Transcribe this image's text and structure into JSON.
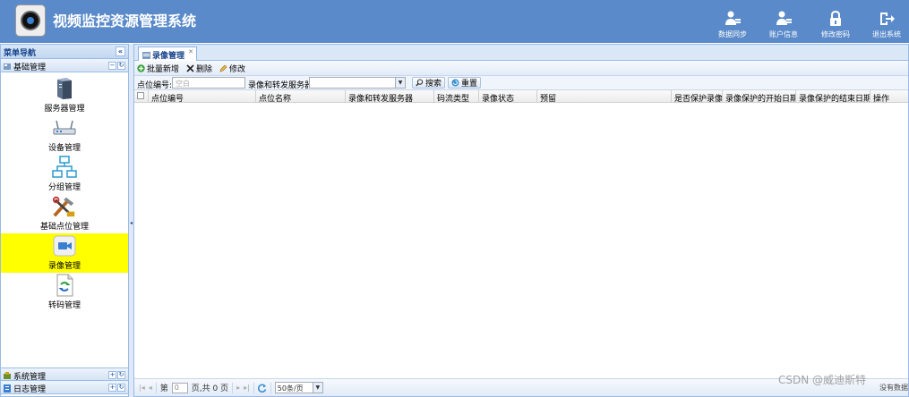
{
  "app": {
    "title": "视频监控资源管理系统"
  },
  "header_buttons": [
    {
      "label": "数据同步",
      "icon": "data-sync-icon"
    },
    {
      "label": "账户信息",
      "icon": "account-info-icon"
    },
    {
      "label": "修改密码",
      "icon": "lock-icon"
    },
    {
      "label": "退出系统",
      "icon": "logout-icon"
    }
  ],
  "left_panel": {
    "title": "菜单导航",
    "sections": [
      {
        "label": "基础管理",
        "expanded": true
      },
      {
        "label": "系统管理"
      },
      {
        "label": "日志管理"
      }
    ],
    "menu_items": [
      {
        "label": "服务器管理",
        "icon": "server-icon",
        "active": false
      },
      {
        "label": "设备管理",
        "icon": "device-icon",
        "active": false
      },
      {
        "label": "分组管理",
        "icon": "group-icon",
        "active": false
      },
      {
        "label": "基础点位管理",
        "icon": "tools-icon",
        "active": false
      },
      {
        "label": "录像管理",
        "icon": "video-camera-icon",
        "active": true
      },
      {
        "label": "转码管理",
        "icon": "transcode-icon",
        "active": false
      }
    ]
  },
  "main": {
    "tab": {
      "label": "录像管理"
    },
    "toolbar": {
      "batch_add": "批量新增",
      "delete": "删除",
      "edit": "修改"
    },
    "search": {
      "point_code_label": "点位编号:",
      "point_code_placeholder": "空白",
      "server_label": "录像和转发服务器:",
      "server_value": "",
      "search_button": "搜索",
      "reset_button": "重置"
    },
    "table": {
      "columns": [
        "点位编号",
        "点位名称",
        "录像和转发服务器",
        "码流类型",
        "录像状态",
        "预留",
        "是否保护录像",
        "录像保护的开始日期",
        "录像保护的结束日期",
        "操作"
      ],
      "rows": []
    },
    "pager": {
      "page_prefix": "第",
      "page_value": "0",
      "page_suffix": "页,共 0 页",
      "page_size": "50条/页"
    }
  },
  "watermark": {
    "text": "CSDN @威迪斯特",
    "extra": "没有数据"
  },
  "colors": {
    "header": "#5a8ac9",
    "active_menu": "#ffff00",
    "border": "#99bbe8"
  }
}
